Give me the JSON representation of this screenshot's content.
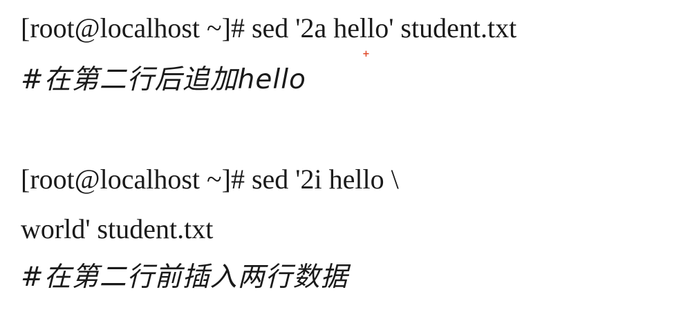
{
  "colors": {
    "text": "#1a1a1a",
    "background": "#ffffff",
    "cursor_mark": "#e04a2a"
  },
  "block1": {
    "command": "[root@localhost ~]# sed '2a hello' student.txt",
    "comment": "#在第二行后追加hello"
  },
  "cursor_mark": "+",
  "block2": {
    "command_line1": "[root@localhost ~]# sed '2i hello \\",
    "command_line2": "world' student.txt",
    "comment": "#在第二行前插入两行数据"
  }
}
